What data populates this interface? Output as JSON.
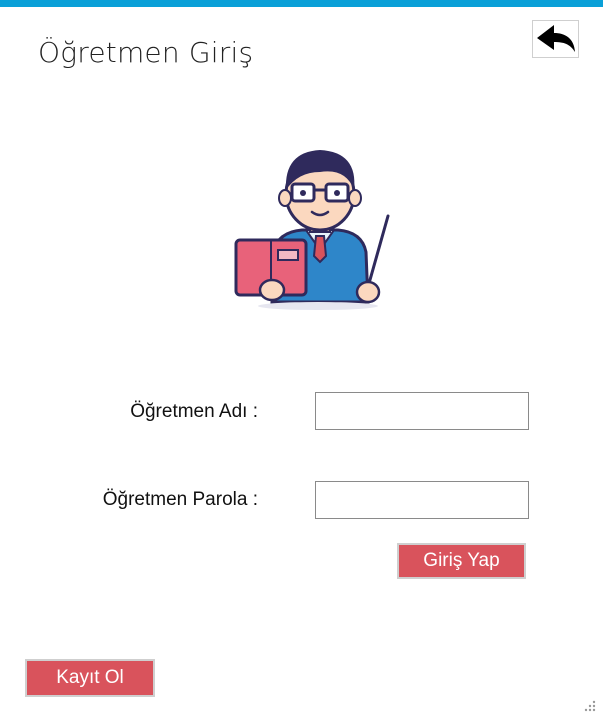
{
  "window": {
    "title": "Öğretmen Giriş",
    "accent_color": "#0aa0d8"
  },
  "header": {
    "back_icon": "back-arrow-icon"
  },
  "illustration": {
    "icon": "teacher-icon"
  },
  "form": {
    "name_label": "Öğretmen Adı :",
    "name_value": "",
    "password_label": "Öğretmen Parola :",
    "password_value": "",
    "login_label": "Giriş Yap",
    "button_color": "#d9535c"
  },
  "footer": {
    "register_label": "Kayıt Ol"
  }
}
